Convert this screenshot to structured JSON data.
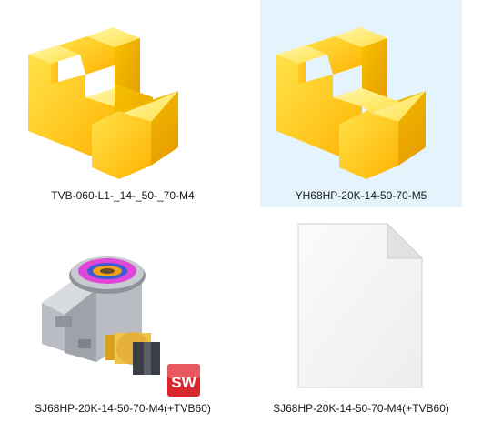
{
  "files": [
    {
      "name": "TVB-060-L1-_14-_50-_70-M4",
      "icon": "solidworks-part-icon",
      "selected": false
    },
    {
      "name": "YH68HP-20K-14-50-70-M5",
      "icon": "solidworks-part-icon",
      "selected": true
    },
    {
      "name": "SJ68HP-20K-14-50-70-M4(+TVB60)",
      "icon": "gearbox-assembly-thumbnail",
      "badge": "solidworks-sw-badge-icon",
      "selected": false
    },
    {
      "name": "SJ68HP-20K-14-50-70-M4(+TVB60)",
      "icon": "blank-document-icon",
      "selected": false
    }
  ],
  "colors": {
    "selection": "#e5f3fd",
    "part_yellow": "#ffd400",
    "sw_red": "#d7262c"
  }
}
